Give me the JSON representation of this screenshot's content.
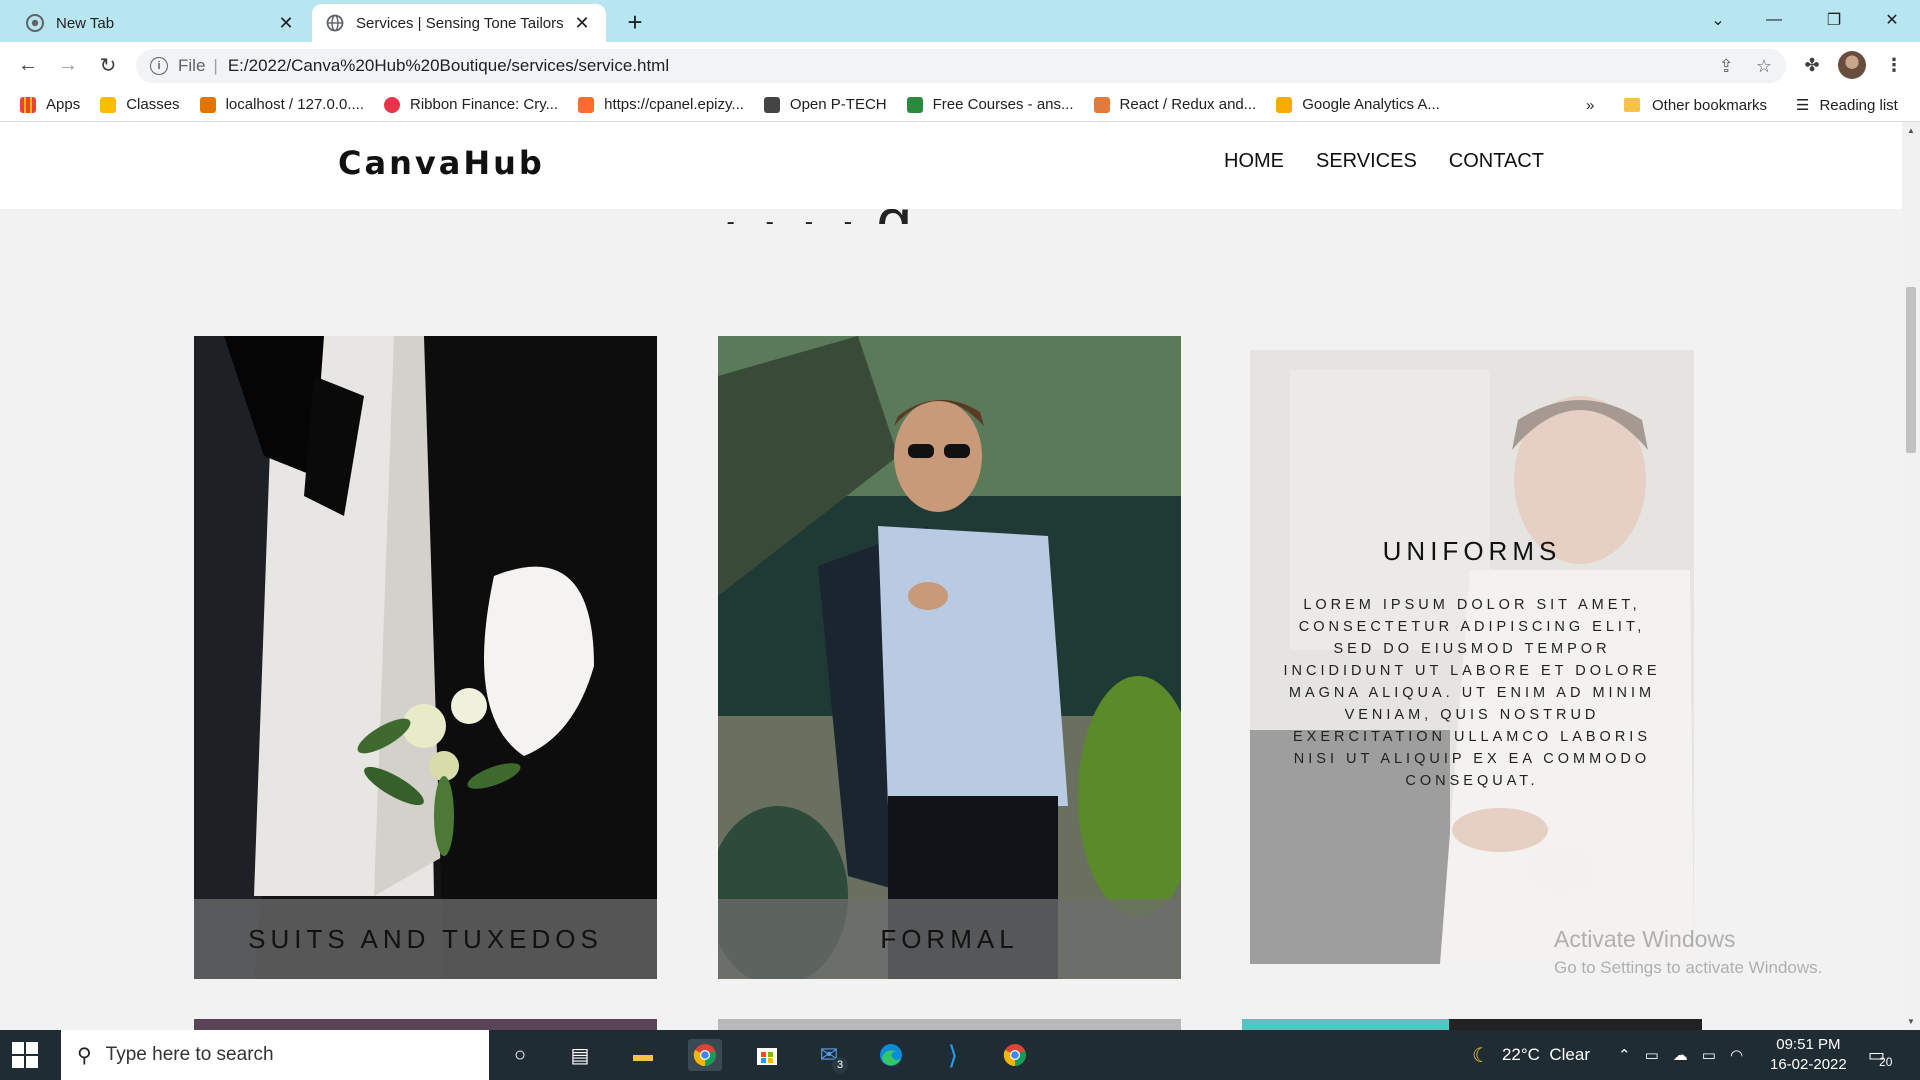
{
  "browser": {
    "tabs": [
      {
        "title": "New Tab",
        "active": false
      },
      {
        "title": "Services | Sensing Tone Tailors",
        "active": true
      }
    ],
    "new_tab_label": "+",
    "address": {
      "scheme": "File",
      "separator": "|",
      "url": "E:/2022/Canva%20Hub%20Boutique/services/service.html"
    },
    "bookmarks": [
      {
        "label": "Apps",
        "color": "#ea4335"
      },
      {
        "label": "Classes",
        "color": "#fbbc04"
      },
      {
        "label": "localhost / 127.0.0....",
        "color": "#e37400"
      },
      {
        "label": "Ribbon Finance: Cry...",
        "color": "#e8334a"
      },
      {
        "label": "https://cpanel.epizy...",
        "color": "#ff6c2c"
      },
      {
        "label": "Open P-TECH",
        "color": "#444444"
      },
      {
        "label": "Free Courses - ans...",
        "color": "#2b8a3e"
      },
      {
        "label": "React / Redux and...",
        "color": "#e07b39"
      },
      {
        "label": "Google Analytics A...",
        "color": "#f9ab00"
      }
    ],
    "overflow_label": "»",
    "other_bookmarks": "Other bookmarks",
    "reading_list": "Reading list"
  },
  "site": {
    "logo": "CanvaHub",
    "nav": [
      "HOME",
      "SERVICES",
      "CONTACT"
    ],
    "heading_fragment": "· · · · g",
    "cards": [
      {
        "title": "SUITS AND TUXEDOS"
      },
      {
        "title": "FORMAL"
      },
      {
        "title": "UNIFORMS",
        "description": "Lorem ipsum dolor sit amet, consectetur adipiscing elit, sed do eiusmod tempor incididunt ut labore et dolore magna aliqua. Ut enim ad minim veniam, quis nostrud exercitation ullamco laboris nisi ut aliquip ex ea commodo consequat."
      }
    ]
  },
  "watermark": {
    "line1": "Activate Windows",
    "line2": "Go to Settings to activate Windows."
  },
  "taskbar": {
    "search_placeholder": "Type here to search",
    "mail_badge": "3",
    "weather": "22°C  Clear",
    "time": "09:51 PM",
    "date": "16-02-2022",
    "notifications": "20"
  }
}
